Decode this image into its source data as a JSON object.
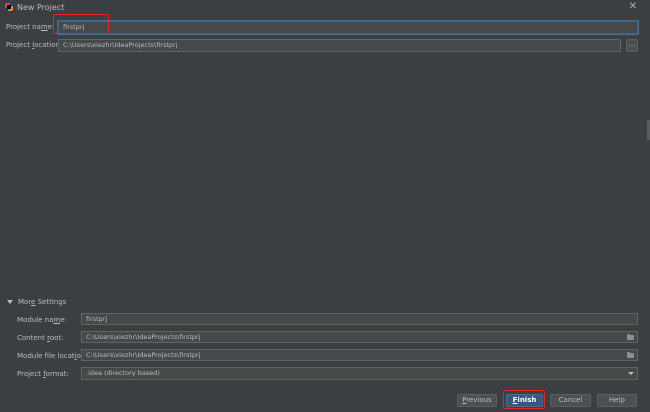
{
  "window": {
    "title": "New Project",
    "close_symbol": "✕"
  },
  "main": {
    "project_name": {
      "label_pre": "Project na",
      "label_u": "m",
      "label_post": "e:",
      "value": "firstprj"
    },
    "project_location": {
      "label_pre": "Project ",
      "label_u": "l",
      "label_post": "ocation:",
      "value": "C:\\Users\\xiezhr\\IdeaProjects\\firstprj",
      "browse_label": "..."
    }
  },
  "more_settings": {
    "label_pre": "Mor",
    "label_u": "e",
    "label_post": " Settings",
    "module_name": {
      "label_pre": "Module na",
      "label_u": "m",
      "label_post": "e:",
      "value": "firstprj"
    },
    "content_root": {
      "label_pre": "Content ",
      "label_u": "r",
      "label_post": "oot:",
      "value": "C:\\Users\\xiezhr\\IdeaProjects\\firstprj"
    },
    "module_file_location": {
      "label_pre": "Module file locat",
      "label_u": "i",
      "label_post": "on:",
      "value": "C:\\Users\\xiezhr\\IdeaProjects\\firstprj"
    },
    "project_format": {
      "label_pre": "Project ",
      "label_u": "f",
      "label_post": "ormat:",
      "value": ".idea (directory based)"
    }
  },
  "buttons": {
    "previous": {
      "pre": "",
      "u": "P",
      "post": "revious"
    },
    "finish": {
      "pre": "",
      "u": "F",
      "post": "inish"
    },
    "cancel": {
      "pre": "Cancel",
      "u": "",
      "post": ""
    },
    "help": {
      "pre": "Help",
      "u": "",
      "post": ""
    }
  },
  "colors": {
    "background": "#3c3f41",
    "input_background": "#45494a",
    "primary_button": "#365880",
    "highlight_annotation": "#e52424"
  }
}
